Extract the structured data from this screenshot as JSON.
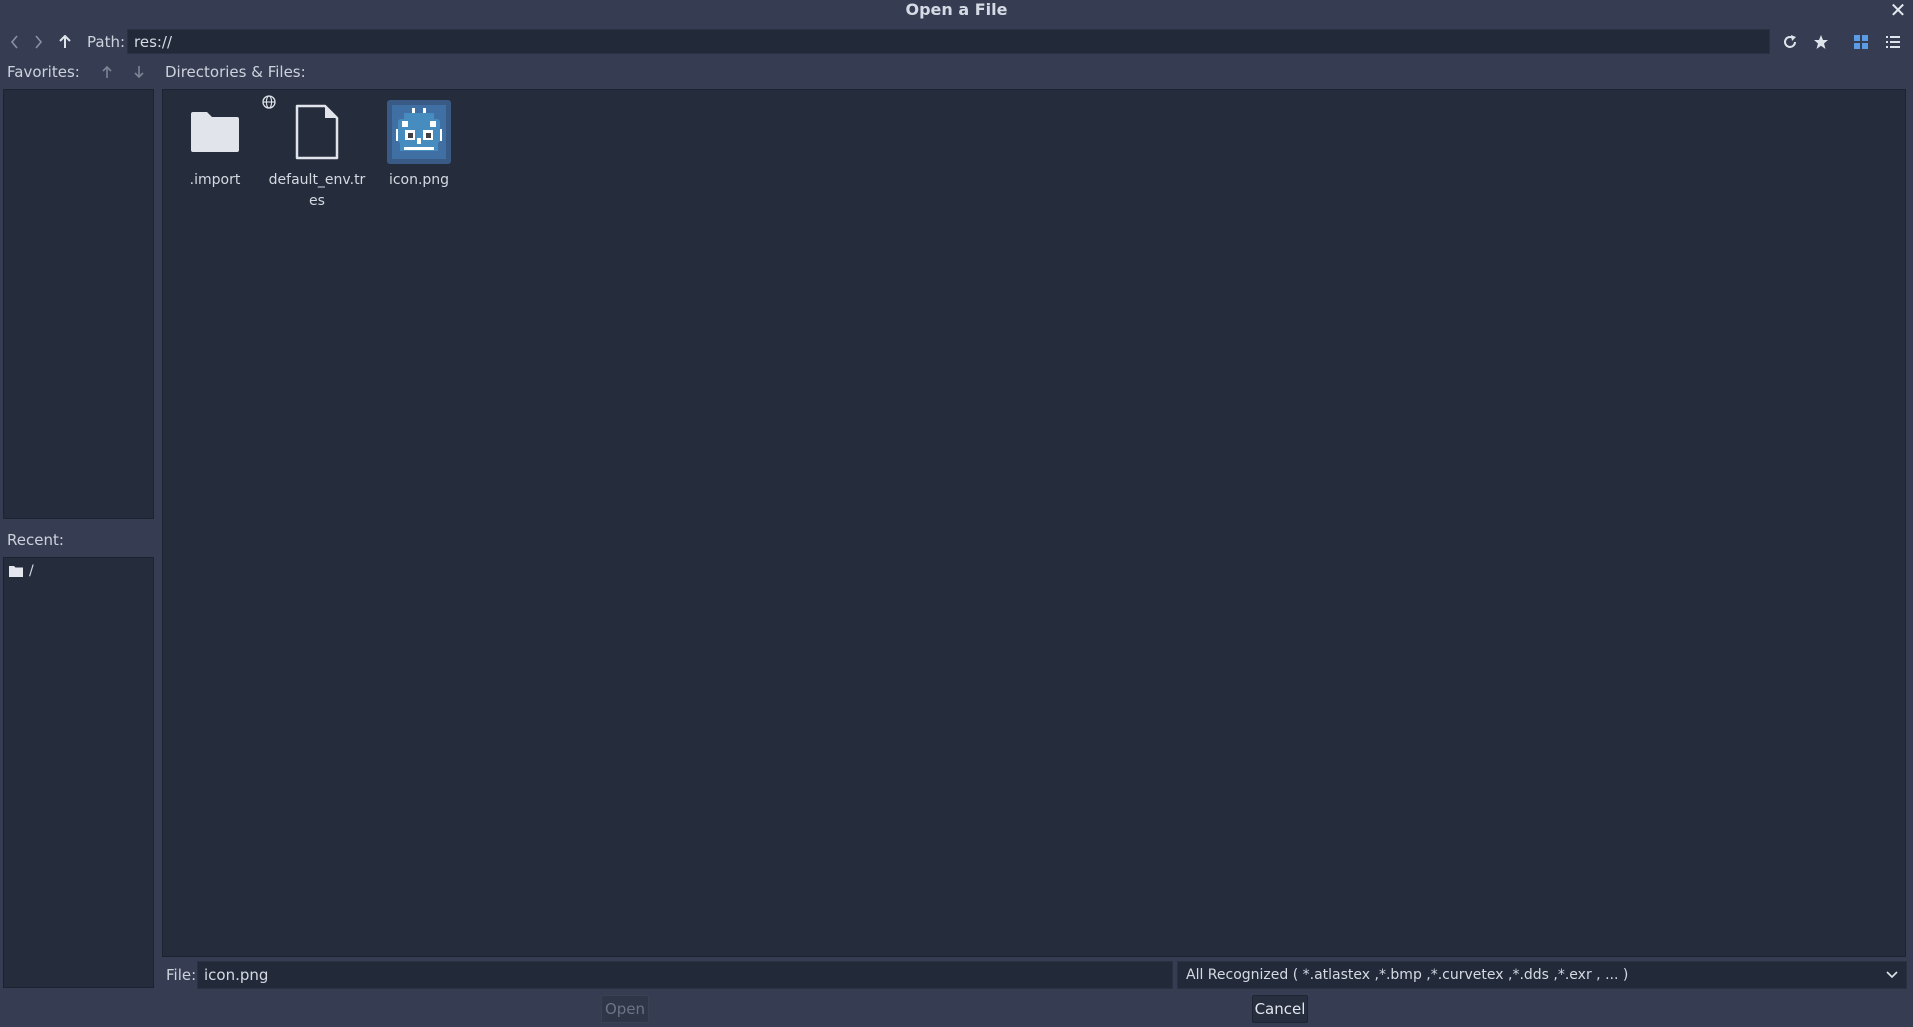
{
  "window": {
    "title": "Open a File"
  },
  "toolbar": {
    "path_label": "Path:",
    "path_value": "res://"
  },
  "favorites": {
    "label": "Favorites:"
  },
  "recent": {
    "label": "Recent:",
    "items": [
      {
        "name": "/"
      }
    ]
  },
  "browser": {
    "label": "Directories & Files:",
    "items": [
      {
        "name": ".import",
        "icon": "folder-icon",
        "selected": false
      },
      {
        "name": "default_env.tres",
        "icon": "file-icon",
        "selected": false
      },
      {
        "name": "icon.png",
        "icon": "image-thumbnail",
        "selected": true
      }
    ]
  },
  "bottom": {
    "file_label": "File:",
    "file_value": "icon.png",
    "filter_value": "All Recognized ( *.atlastex ,*.bmp ,*.curvetex ,*.dds ,*.exr , ... )"
  },
  "buttons": {
    "open_label": "Open",
    "cancel_label": "Cancel"
  },
  "colors": {
    "background": "#363d52",
    "panel": "#252c3c",
    "accent": "#5c9be6"
  }
}
